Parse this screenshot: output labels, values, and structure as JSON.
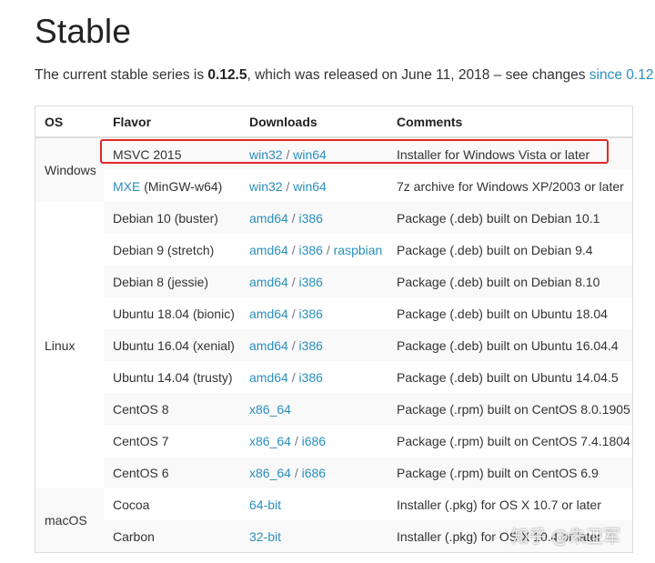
{
  "page": {
    "title": "Stable",
    "intro": {
      "prefix": "The current stable series is ",
      "version": "0.12.5",
      "middle": ", which was released on June 11, 2018 – see changes ",
      "link": "since 0.12"
    }
  },
  "table": {
    "headers": {
      "os": "OS",
      "flavor": "Flavor",
      "downloads": "Downloads",
      "comments": "Comments"
    },
    "groups": {
      "windows": "Windows",
      "linux": "Linux",
      "macos": "macOS"
    },
    "rows": [
      {
        "flavor": "MSVC 2015",
        "flavor_link": "",
        "flavor_suffix": "",
        "downloads": [
          "win32",
          "win64"
        ],
        "comment": "Installer for Windows Vista or later"
      },
      {
        "flavor": "",
        "flavor_link": "MXE",
        "flavor_suffix": " (MinGW-w64)",
        "downloads": [
          "win32",
          "win64"
        ],
        "comment": "7z archive for Windows XP/2003 or later"
      },
      {
        "flavor": "Debian 10 (buster)",
        "downloads": [
          "amd64",
          "i386"
        ],
        "comment": "Package (.deb) built on Debian 10.1"
      },
      {
        "flavor": "Debian 9 (stretch)",
        "downloads": [
          "amd64",
          "i386",
          "raspbian"
        ],
        "comment": "Package (.deb) built on Debian 9.4"
      },
      {
        "flavor": "Debian 8 (jessie)",
        "downloads": [
          "amd64",
          "i386"
        ],
        "comment": "Package (.deb) built on Debian 8.10"
      },
      {
        "flavor": "Ubuntu 18.04 (bionic)",
        "downloads": [
          "amd64",
          "i386"
        ],
        "comment": "Package (.deb) built on Ubuntu 18.04"
      },
      {
        "flavor": "Ubuntu 16.04 (xenial)",
        "downloads": [
          "amd64",
          "i386"
        ],
        "comment": "Package (.deb) built on Ubuntu 16.04.4"
      },
      {
        "flavor": "Ubuntu 14.04 (trusty)",
        "downloads": [
          "amd64",
          "i386"
        ],
        "comment": "Package (.deb) built on Ubuntu 14.04.5"
      },
      {
        "flavor": "CentOS 8",
        "downloads": [
          "x86_64"
        ],
        "comment": "Package (.rpm) built on CentOS 8.0.1905"
      },
      {
        "flavor": "CentOS 7",
        "downloads": [
          "x86_64",
          "i686"
        ],
        "comment": "Package (.rpm) built on CentOS 7.4.1804"
      },
      {
        "flavor": "CentOS 6",
        "downloads": [
          "x86_64",
          "i686"
        ],
        "comment": "Package (.rpm) built on CentOS 6.9"
      },
      {
        "flavor": "Cocoa",
        "downloads": [
          "64-bit"
        ],
        "comment": "Installer (.pkg) for OS X 10.7 or later"
      },
      {
        "flavor": "Carbon",
        "downloads": [
          "32-bit"
        ],
        "comment": "Installer (.pkg) for OS X 10.4 or later"
      }
    ],
    "separator": " / "
  },
  "watermark": "知乎 @朱卫军",
  "colors": {
    "link": "#2a8fbd",
    "highlight_border": "#e0282a",
    "row_stripe": "#f9f9f9",
    "border": "#dddddd"
  }
}
